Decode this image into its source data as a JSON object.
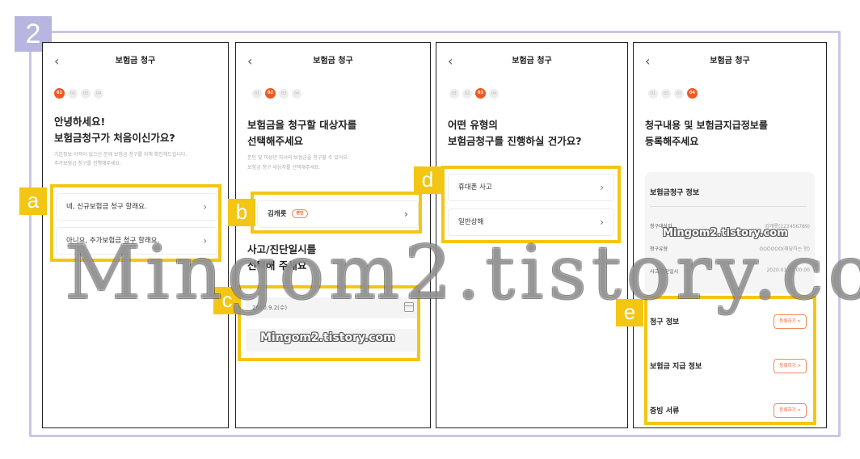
{
  "step_number": "2",
  "screens": [
    {
      "title": "보험금 청구",
      "back": "‹",
      "steps": [
        "01",
        "02",
        "03",
        "04"
      ],
      "active_step": 0,
      "heading": [
        "안녕하세요!",
        "보험금청구가 처음이신가요?"
      ],
      "sub": [
        "기본정보 이력이 없으신 분께 보험금 청구를 위해 확인해드립니다.",
        "추가보험금 청구를 진행해주세요."
      ],
      "options": [
        "네, 신규보험금 청구 할래요.",
        "아니요, 추가보험금 청구 할래요."
      ],
      "highlight_label": "a"
    },
    {
      "title": "보험금 청구",
      "back": "‹",
      "steps": [
        "01",
        "02",
        "03",
        "04"
      ],
      "active_step": 1,
      "heading": [
        "보험금을 청구할 대상자를",
        "선택해주세요"
      ],
      "sub": [
        "본인 및 미성년 자녀의 보험금을 청구할 수 있어요.",
        "보험금 청구 대상자를 선택해주세요."
      ],
      "person_name": "김캐롯",
      "person_badge": "본인",
      "highlight_label_b": "b",
      "heading2": [
        "사고/진단일시를",
        "선택해 주세요"
      ],
      "date_value": "2020.9.2(수)",
      "watermark": "Mingom2.tistory.com",
      "highlight_label_c": "c"
    },
    {
      "title": "보험금 청구",
      "back": "‹",
      "steps": [
        "01",
        "02",
        "03",
        "04"
      ],
      "active_step": 2,
      "heading": [
        "어떤 유형의",
        "보험금청구를 진행하실 건가요?"
      ],
      "options": [
        "휴대폰 사고",
        "일반상해"
      ],
      "highlight_label": "d"
    },
    {
      "title": "보험금 청구",
      "back": "‹",
      "steps": [
        "01",
        "02",
        "03",
        "04"
      ],
      "active_step": 3,
      "heading": [
        "청구내용 및 보험금지급정보를",
        "등록해주세요"
      ],
      "info_title": "보험금청구 정보",
      "rows": [
        {
          "k": "청구대상자",
          "v": "김캐롯(123456789)"
        },
        {
          "k": "청구유형",
          "v": "OOOOOO(해당하는 항)"
        },
        {
          "k": "사고/진단일시",
          "v": "2020.01.01 00:00"
        }
      ],
      "watermark": "Mingom2.tistory.com",
      "sections": [
        {
          "t": "청구 정보",
          "b": "등록하기 >"
        },
        {
          "t": "보험금 지급 정보",
          "b": "등록하기 >"
        },
        {
          "t": "증빙 서류",
          "b": "등록하기 >"
        }
      ],
      "highlight_label": "e"
    }
  ],
  "big_watermark": "Mingom2.tistory.com",
  "colors": {
    "accent": "#ef5a22",
    "highlight": "#f3c613",
    "frame": "#c9c6e6"
  }
}
